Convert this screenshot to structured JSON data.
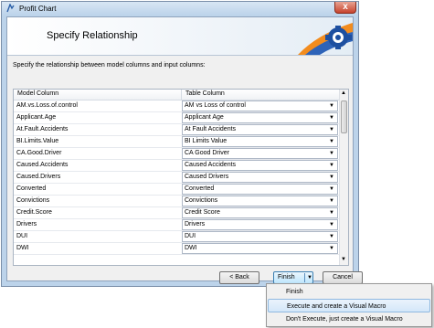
{
  "window": {
    "title": "Profit Chart",
    "close_label": "x"
  },
  "header": {
    "title": "Specify Relationship"
  },
  "instructions": "Specify the relationship between model columns and input columns:",
  "grid": {
    "columns": [
      "Model Column",
      "Table Column"
    ],
    "rows": [
      {
        "model": "AM.vs.Loss.of.control",
        "table": "AM vs Loss of control"
      },
      {
        "model": "Applicant.Age",
        "table": "Applicant Age"
      },
      {
        "model": "At.Fault.Accidents",
        "table": "At Fault Accidents"
      },
      {
        "model": "BI.Limits.Value",
        "table": "BI Limits Value"
      },
      {
        "model": "CA.Good.Driver",
        "table": "CA Good Driver"
      },
      {
        "model": "Caused.Accidents",
        "table": "Caused Accidents"
      },
      {
        "model": "Caused.Drivers",
        "table": "Caused Drivers"
      },
      {
        "model": "Converted",
        "table": "Converted"
      },
      {
        "model": "Convictions",
        "table": "Convictions"
      },
      {
        "model": "Credit.Score",
        "table": "Credit Score"
      },
      {
        "model": "Drivers",
        "table": "Drivers"
      },
      {
        "model": "DUI",
        "table": "DUI"
      },
      {
        "model": "DWI",
        "table": "DWI"
      }
    ]
  },
  "buttons": {
    "back": "Back",
    "finish": "Finish",
    "cancel": "Cancel"
  },
  "menu": {
    "items": [
      {
        "label": "Finish"
      },
      {
        "label": "Execute and create a Visual Macro"
      },
      {
        "label": "Don't Execute, just create a Visual Macro"
      }
    ],
    "active_index": 1
  },
  "colors": {
    "title_bar": "#bcd3ea",
    "close_button": "#c7432d",
    "finish_button": "#bee6fd",
    "menu_highlight": "#d4e7f9"
  },
  "icons": [
    "app-icon",
    "close-icon",
    "logo-graphic",
    "scroll-up-icon",
    "scroll-down-icon",
    "dropdown-arrow-icon"
  ]
}
